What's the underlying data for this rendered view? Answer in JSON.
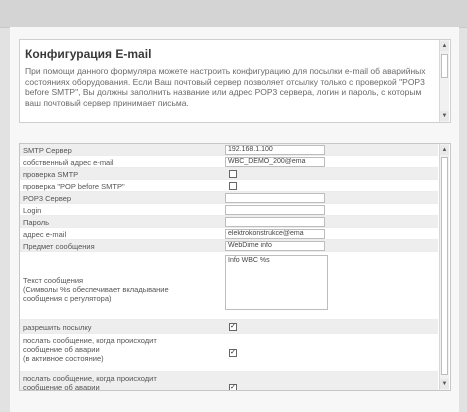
{
  "intro": {
    "title": "Конфигурация E-mail",
    "text": "При помощи данного формуляра можете настроить конфигурацию для посылки e-mail об аварийных состояниях оборудования. Если Ваш почтовый сервер позволяет отсылку только с проверкой \"POP3 before SMTP\", Вы должны заполнить название или адрес POP3 сервера, логин и пароль, с которым ваш почтовый сервер принимает письма."
  },
  "form": {
    "smtp_server": {
      "label": "SMTP Сервер",
      "value": "192.168.1.100"
    },
    "own_email": {
      "label": "собственный адрес e-mail",
      "value": "WBC_DEMO_200@ema"
    },
    "smtp_check": {
      "label": "проверка SMTP",
      "checked": false
    },
    "pop_check": {
      "label": "проверка \"POP before SMTP\"",
      "checked": false
    },
    "pop3_server": {
      "label": "POP3 Сервер",
      "value": ""
    },
    "login": {
      "label": "Login",
      "value": ""
    },
    "password": {
      "label": "Пароль",
      "value": ""
    },
    "email_address": {
      "label": "адрес e-mail",
      "value": "elektrokonstrukce@ema"
    },
    "subject": {
      "label": "Предмет сообщения",
      "value": "WebDime info"
    },
    "message": {
      "label_line1": "Текст сообщения",
      "label_line2": "(Символы %s обеспечивает вкладывание",
      "label_line3": "сообщения с регулятора)",
      "value": "Info WBC %s"
    },
    "allow_send": {
      "label": "разрешить посылку",
      "checked": true
    },
    "alarm_active": {
      "label_line1": "послать сообщение, когда происходит",
      "label_line2": "сообщение об аварии",
      "label_line3": "(в активное состояние)",
      "checked": true
    },
    "alarm_inactive": {
      "label_line1": "послать сообщение, когда происходит",
      "label_line2": "сообщение об аварии",
      "checked": true
    }
  },
  "icons": {
    "up": "arrow-up-icon",
    "down": "arrow-down-icon"
  }
}
